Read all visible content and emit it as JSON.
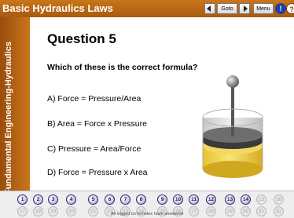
{
  "app": {
    "title": "Basic Hydraulics Laws"
  },
  "toolbar": {
    "goto_label": "Goto",
    "menu_label": "Menu",
    "info_glyph": "!",
    "help_glyph": "?"
  },
  "sidebar": {
    "course_title": "Fundamental Engineering-Hydraulics"
  },
  "question": {
    "title": "Question 5",
    "text": "Which of these is the correct formula?",
    "answers": [
      {
        "label": "A) Force = Pressure/Area"
      },
      {
        "label": "B) Area = Force x Pressure"
      },
      {
        "label": "C) Pressure = Area/Force"
      },
      {
        "label": "D) Force = Pressure x Area"
      }
    ]
  },
  "nav": {
    "answered": [
      "1",
      "2",
      "3",
      "4",
      "5",
      "6",
      "7",
      "8",
      "9",
      "10",
      "11",
      "12",
      "13",
      "14",
      "15",
      "16"
    ],
    "remaining": [
      "17",
      "18",
      "19",
      "20",
      "21",
      "22",
      "23",
      "24",
      "25",
      "26",
      "27",
      "28",
      "29",
      "30",
      "31",
      "32"
    ],
    "status": "All logged on remotes have answered"
  },
  "colors": {
    "title_bar": "#b8661a",
    "sidebar": "#a85a12",
    "accent_navy": "#2c2c6a"
  }
}
